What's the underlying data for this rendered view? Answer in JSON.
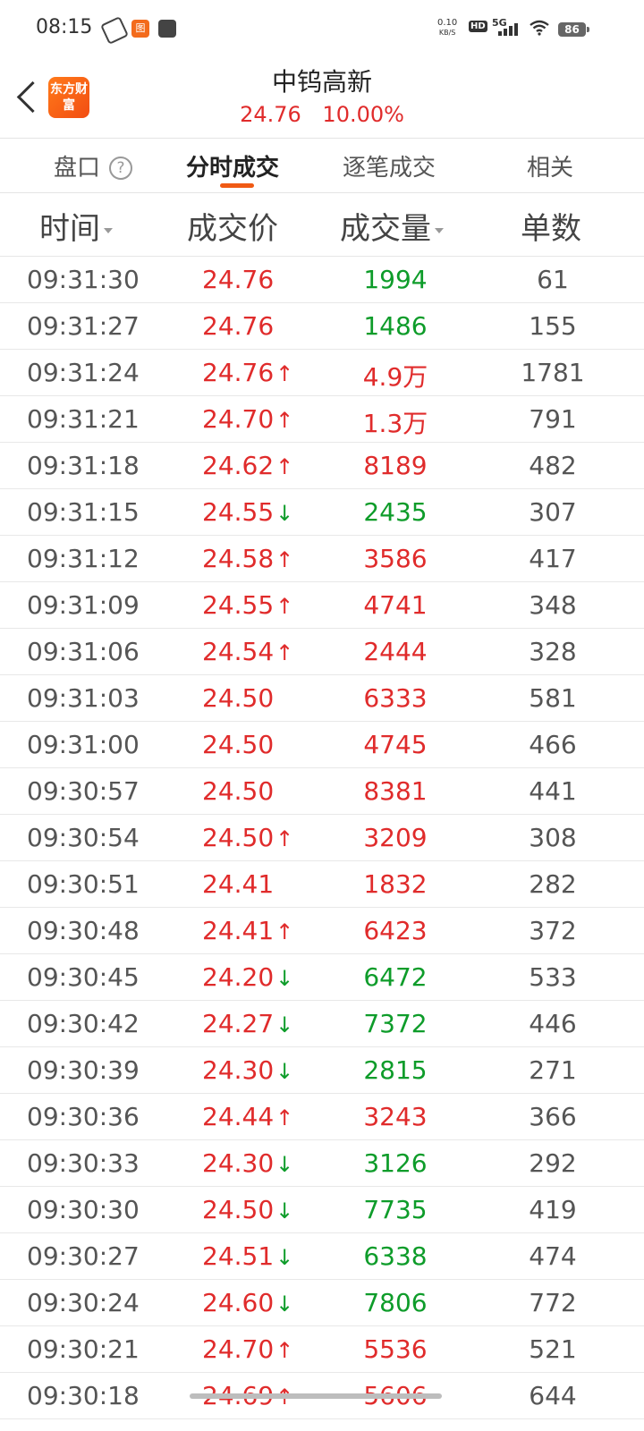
{
  "status_bar": {
    "time": "08:15",
    "app1_label": "图",
    "speed_value": "0.10",
    "speed_unit": "KB/S",
    "hd": "HD",
    "network": "5G",
    "battery": "86"
  },
  "header": {
    "logo_text": "东方财富",
    "stock_name": "中钨高新",
    "price": "24.76",
    "change_pct": "10.00%"
  },
  "tabs": [
    {
      "label": "盘口"
    },
    {
      "label": "分时成交"
    },
    {
      "label": "逐笔成交"
    },
    {
      "label": "相关"
    }
  ],
  "columns": {
    "time": "时间",
    "price": "成交价",
    "volume": "成交量",
    "count": "单数"
  },
  "colors": {
    "up": "#e02b2b",
    "down": "#0e9c2a",
    "accent": "#f05a14"
  },
  "rows": [
    {
      "time": "09:31:30",
      "price": "24.76",
      "arrow": "",
      "volume": "1994",
      "vol_color": "green",
      "count": "61"
    },
    {
      "time": "09:31:27",
      "price": "24.76",
      "arrow": "",
      "volume": "1486",
      "vol_color": "green",
      "count": "155"
    },
    {
      "time": "09:31:24",
      "price": "24.76",
      "arrow": "up",
      "volume": "4.9万",
      "vol_color": "red",
      "count": "1781"
    },
    {
      "time": "09:31:21",
      "price": "24.70",
      "arrow": "up",
      "volume": "1.3万",
      "vol_color": "red",
      "count": "791"
    },
    {
      "time": "09:31:18",
      "price": "24.62",
      "arrow": "up",
      "volume": "8189",
      "vol_color": "red",
      "count": "482"
    },
    {
      "time": "09:31:15",
      "price": "24.55",
      "arrow": "down",
      "volume": "2435",
      "vol_color": "green",
      "count": "307"
    },
    {
      "time": "09:31:12",
      "price": "24.58",
      "arrow": "up",
      "volume": "3586",
      "vol_color": "red",
      "count": "417"
    },
    {
      "time": "09:31:09",
      "price": "24.55",
      "arrow": "up",
      "volume": "4741",
      "vol_color": "red",
      "count": "348"
    },
    {
      "time": "09:31:06",
      "price": "24.54",
      "arrow": "up",
      "volume": "2444",
      "vol_color": "red",
      "count": "328"
    },
    {
      "time": "09:31:03",
      "price": "24.50",
      "arrow": "",
      "volume": "6333",
      "vol_color": "red",
      "count": "581"
    },
    {
      "time": "09:31:00",
      "price": "24.50",
      "arrow": "",
      "volume": "4745",
      "vol_color": "red",
      "count": "466"
    },
    {
      "time": "09:30:57",
      "price": "24.50",
      "arrow": "",
      "volume": "8381",
      "vol_color": "red",
      "count": "441"
    },
    {
      "time": "09:30:54",
      "price": "24.50",
      "arrow": "up",
      "volume": "3209",
      "vol_color": "red",
      "count": "308"
    },
    {
      "time": "09:30:51",
      "price": "24.41",
      "arrow": "",
      "volume": "1832",
      "vol_color": "red",
      "count": "282"
    },
    {
      "time": "09:30:48",
      "price": "24.41",
      "arrow": "up",
      "volume": "6423",
      "vol_color": "red",
      "count": "372"
    },
    {
      "time": "09:30:45",
      "price": "24.20",
      "arrow": "down",
      "volume": "6472",
      "vol_color": "green",
      "count": "533"
    },
    {
      "time": "09:30:42",
      "price": "24.27",
      "arrow": "down",
      "volume": "7372",
      "vol_color": "green",
      "count": "446"
    },
    {
      "time": "09:30:39",
      "price": "24.30",
      "arrow": "down",
      "volume": "2815",
      "vol_color": "green",
      "count": "271"
    },
    {
      "time": "09:30:36",
      "price": "24.44",
      "arrow": "up",
      "volume": "3243",
      "vol_color": "red",
      "count": "366"
    },
    {
      "time": "09:30:33",
      "price": "24.30",
      "arrow": "down",
      "volume": "3126",
      "vol_color": "green",
      "count": "292"
    },
    {
      "time": "09:30:30",
      "price": "24.50",
      "arrow": "down",
      "volume": "7735",
      "vol_color": "green",
      "count": "419"
    },
    {
      "time": "09:30:27",
      "price": "24.51",
      "arrow": "down",
      "volume": "6338",
      "vol_color": "green",
      "count": "474"
    },
    {
      "time": "09:30:24",
      "price": "24.60",
      "arrow": "down",
      "volume": "7806",
      "vol_color": "green",
      "count": "772"
    },
    {
      "time": "09:30:21",
      "price": "24.70",
      "arrow": "up",
      "volume": "5536",
      "vol_color": "red",
      "count": "521"
    },
    {
      "time": "09:30:18",
      "price": "24.69",
      "arrow": "up",
      "volume": "5606",
      "vol_color": "red",
      "count": "644"
    }
  ]
}
